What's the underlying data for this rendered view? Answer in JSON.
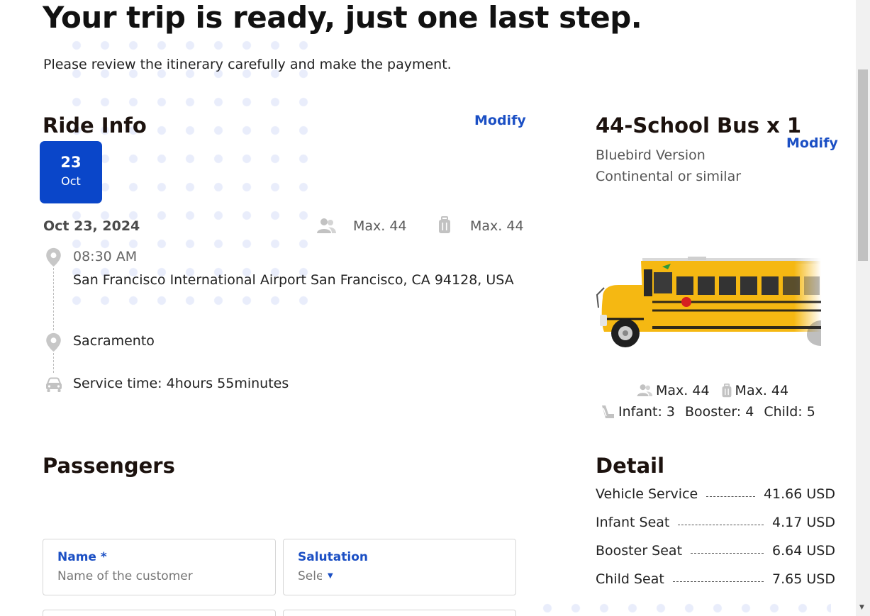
{
  "header": {
    "title": "Your trip is ready, just one last step.",
    "subtitle": "Please review the itinerary carefully and make the payment."
  },
  "ride_info": {
    "title": "Ride Info",
    "modify_label": "Modify",
    "date_badge": {
      "day": "23",
      "month": "Oct"
    },
    "full_date": "Oct 23, 2024",
    "max_passengers": "Max. 44",
    "max_luggage": "Max. 44",
    "pickup_time": "08:30 AM",
    "pickup_address": "San Francisco International Airport San Francisco, CA 94128, USA",
    "dropoff": "Sacramento",
    "service_time": "Service time: 4hours 55minutes"
  },
  "vehicle": {
    "title": "44-School Bus x 1",
    "modify_label": "Modify",
    "version": "Bluebird Version",
    "similar": "Continental or similar",
    "max_passengers": "Max. 44",
    "max_luggage": "Max. 44",
    "infant": "Infant: 3",
    "booster": "Booster: 4",
    "child": "Child: 5",
    "bus_color": "#f5b812"
  },
  "detail": {
    "title": "Detail",
    "items": [
      {
        "label": "Vehicle Service",
        "amount": "41.66 USD"
      },
      {
        "label": "Infant Seat",
        "amount": "4.17 USD"
      },
      {
        "label": "Booster Seat",
        "amount": "6.64 USD"
      },
      {
        "label": "Child Seat",
        "amount": "7.65 USD"
      }
    ]
  },
  "passengers": {
    "title": "Passengers",
    "name_label": "Name *",
    "name_placeholder": "Name of the customer",
    "salutation_label": "Salutation",
    "salutation_value": "Select"
  },
  "colors": {
    "accent": "#0a46c9",
    "link": "#1b4fc4",
    "heading": "#1c120e"
  }
}
